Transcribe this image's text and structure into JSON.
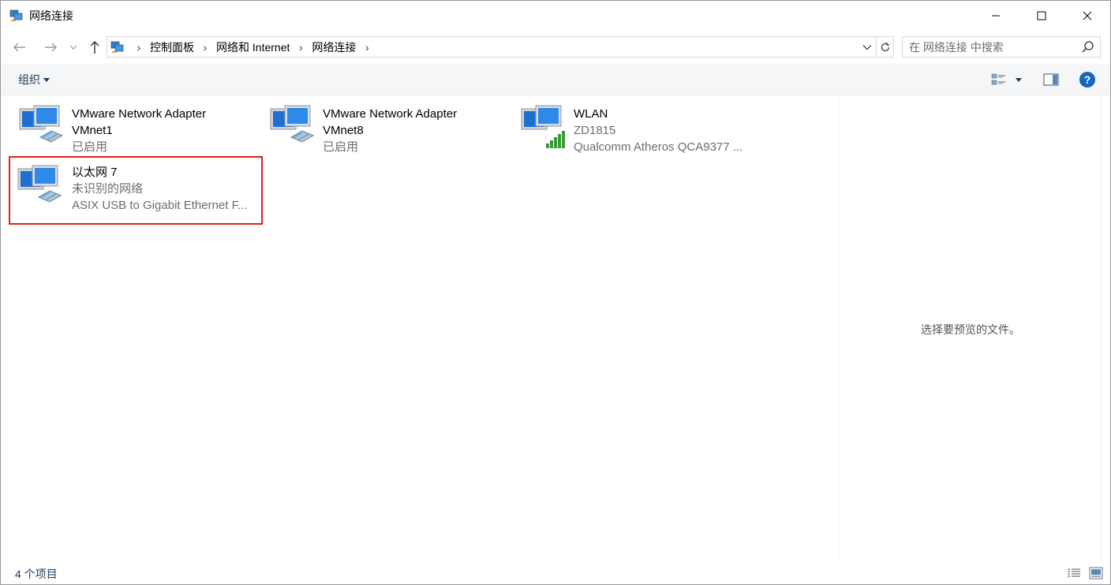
{
  "window": {
    "title": "网络连接",
    "colors": {
      "accent": "#0078d7",
      "selection_outline": "#e02020",
      "secondary_text": "#6d6d6d",
      "command_text": "#1e395b"
    }
  },
  "nav": {
    "breadcrumbs": [
      "控制面板",
      "网络和 Internet",
      "网络连接"
    ],
    "search_placeholder": "在 网络连接 中搜索"
  },
  "command_bar": {
    "organize_label": "组织",
    "icons": [
      "change-view-icon",
      "preview-pane-icon",
      "help-icon"
    ]
  },
  "items": [
    {
      "name": "VMware Network Adapter",
      "name2": "VMnet1",
      "line2": "",
      "line3": "已启用",
      "icon": "network-adapter-icon",
      "selected": false
    },
    {
      "name": "VMware Network Adapter",
      "name2": "VMnet8",
      "line2": "",
      "line3": "已启用",
      "icon": "network-adapter-icon",
      "selected": false
    },
    {
      "name": "WLAN",
      "name2": "",
      "line2": "ZD1815",
      "line3": "Qualcomm Atheros QCA9377 ...",
      "icon": "wifi-adapter-icon",
      "selected": false
    },
    {
      "name": "以太网 7",
      "name2": "",
      "line2": "未识别的网络",
      "line3": "ASIX USB to Gigabit Ethernet F...",
      "icon": "network-adapter-icon",
      "selected": true
    }
  ],
  "preview": {
    "message": "选择要预览的文件。"
  },
  "status": {
    "item_count": "4 个项目"
  }
}
